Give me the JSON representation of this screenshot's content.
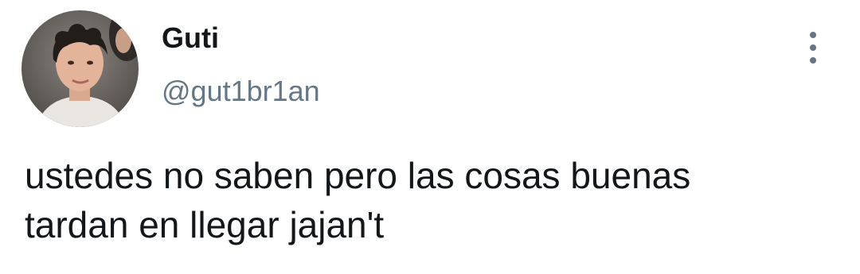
{
  "author": {
    "display_name": "Guti",
    "handle": "@gut1br1an",
    "avatar_icon": "profile-photo"
  },
  "more_icon": "vertical-ellipsis-icon",
  "tweet": {
    "lines": [
      "ustedes no saben pero las cosas buenas",
      "tardan en llegar jajan't"
    ]
  },
  "colors": {
    "text": "#14171a",
    "secondary": "#657786",
    "background": "#ffffff"
  }
}
